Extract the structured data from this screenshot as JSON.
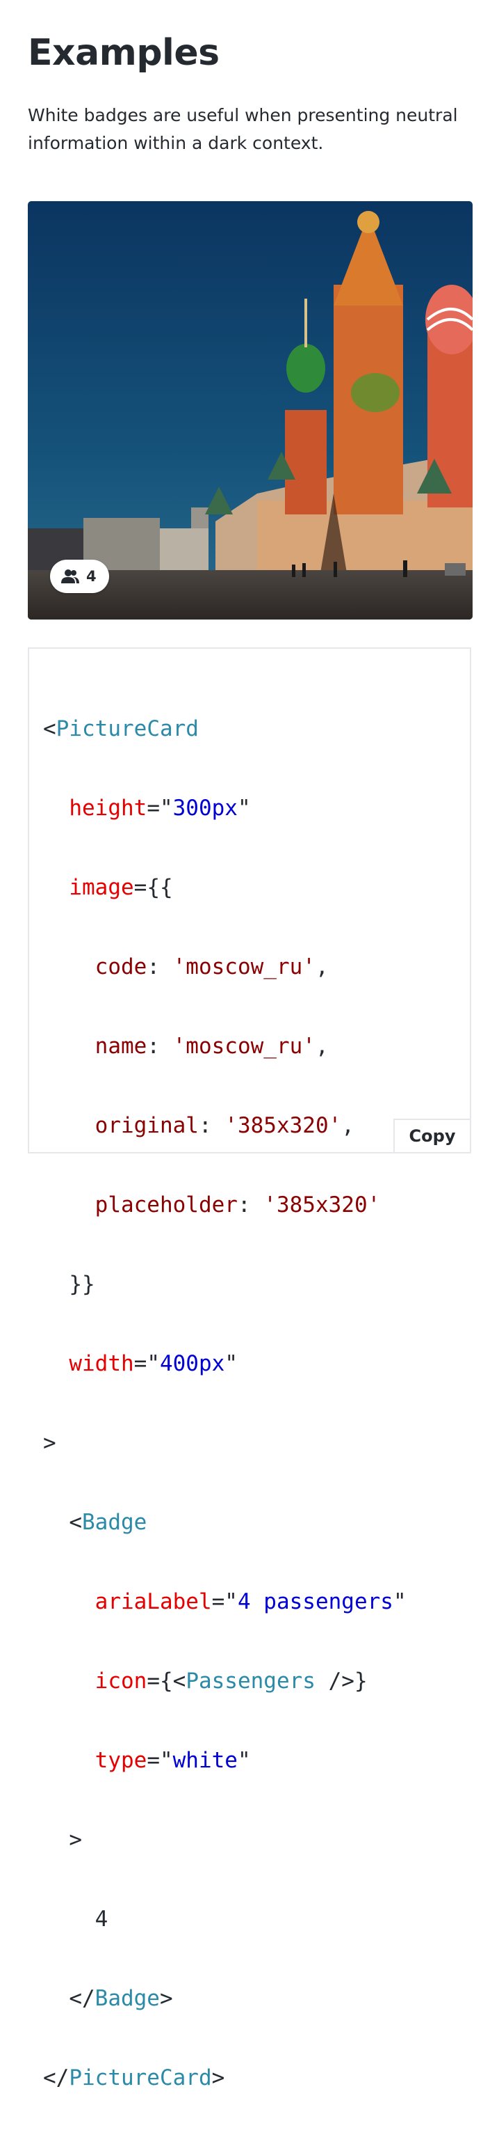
{
  "page": {
    "title": "Examples",
    "intro": "White badges are useful when presenting neutral information within a dark context."
  },
  "picture_card": {
    "image_description_icon": "cathedral-photo",
    "badge": {
      "icon": "passengers-icon",
      "count": "4"
    }
  },
  "code": {
    "l1_open": "<",
    "l1_tag": "PictureCard",
    "l2_attr": "height",
    "l2_eq": "=\"",
    "l2_val": "300px",
    "l2_q": "\"",
    "l3_attr": "image",
    "l3_rest": "={{",
    "l4_prop": "code",
    "l4_colon": ": ",
    "l4_val": "'moscow_ru'",
    "l4_comma": ",",
    "l5_prop": "name",
    "l5_colon": ": ",
    "l5_val": "'moscow_ru'",
    "l5_comma": ",",
    "l6_prop": "original",
    "l6_colon": ": ",
    "l6_val": "'385x320'",
    "l6_comma": ",",
    "l7_prop": "placeholder",
    "l7_colon": ": ",
    "l7_val": "'385x320'",
    "l8": "}}",
    "l9_attr": "width",
    "l9_eq": "=\"",
    "l9_val": "400px",
    "l9_q": "\"",
    "l10": ">",
    "l11_open": "<",
    "l11_tag": "Badge",
    "l12_attr": "ariaLabel",
    "l12_eq": "=\"",
    "l12_val": "4 passengers",
    "l12_q": "\"",
    "l13_attr": "icon",
    "l13_eq": "={<",
    "l13_tag": "Passengers",
    "l13_close": " />}",
    "l14_attr": "type",
    "l14_eq": "=\"",
    "l14_val": "white",
    "l14_q": "\"",
    "l15": ">",
    "l16": "4",
    "l17_open": "</",
    "l17_tag": "Badge",
    "l17_close": ">",
    "l18_open": "</",
    "l18_tag": "PictureCard",
    "l18_close": ">",
    "copy_label": "Copy"
  },
  "colors": {
    "tag": "#2b8aa8",
    "attr": "#e60000",
    "string": "#0000d6",
    "js_string": "#8b0000",
    "text": "#252a31"
  }
}
